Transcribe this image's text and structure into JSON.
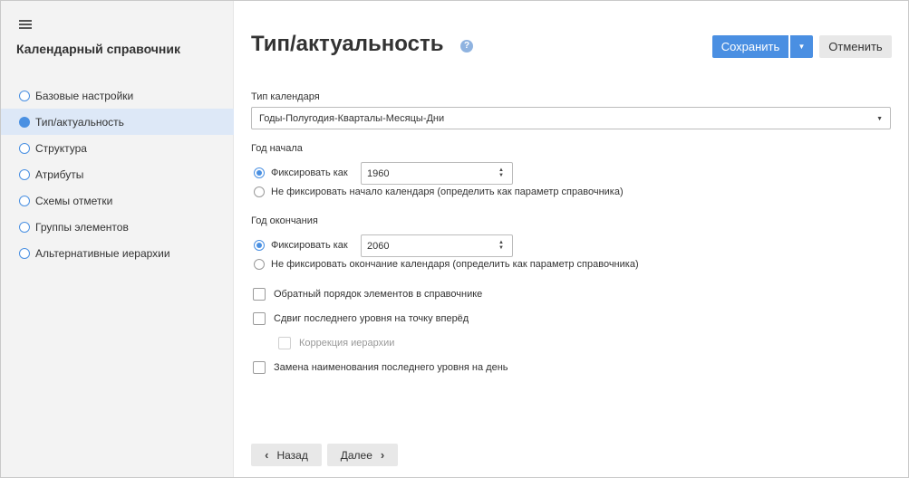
{
  "sidebar": {
    "title": "Календарный справочник",
    "items": [
      {
        "label": "Базовые настройки",
        "active": false
      },
      {
        "label": "Тип/актуальность",
        "active": true
      },
      {
        "label": "Структура",
        "active": false
      },
      {
        "label": "Атрибуты",
        "active": false
      },
      {
        "label": "Схемы отметки",
        "active": false
      },
      {
        "label": "Группы элементов",
        "active": false
      },
      {
        "label": "Альтернативные иерархии",
        "active": false
      }
    ]
  },
  "header": {
    "title": "Тип/актуальность",
    "help_glyph": "?",
    "save_label": "Сохранить",
    "cancel_label": "Отменить"
  },
  "form": {
    "calendar_type": {
      "label": "Тип календаря",
      "value": "Годы-Полугодия-Кварталы-Месяцы-Дни"
    },
    "start_year": {
      "label": "Год начала",
      "fix_label": "Фиксировать как",
      "value": "1960",
      "nofix_label": "Не фиксировать начало календаря (определить как параметр справочника)"
    },
    "end_year": {
      "label": "Год окончания",
      "fix_label": "Фиксировать как",
      "value": "2060",
      "nofix_label": "Не фиксировать окончание календаря (определить как параметр справочника)"
    },
    "options": {
      "reverse_order": "Обратный порядок элементов в справочнике",
      "shift_last_level": "Сдвиг последнего уровня на точку вперёд",
      "hierarchy_correction": "Коррекция иерархии",
      "rename_last_level": "Замена наименования последнего уровня на день"
    }
  },
  "footer": {
    "back_label": "Назад",
    "next_label": "Далее"
  },
  "colors": {
    "accent": "#4a8fe2",
    "sidebar_bg": "#f3f3f3",
    "active_item_bg": "#dde8f7"
  }
}
